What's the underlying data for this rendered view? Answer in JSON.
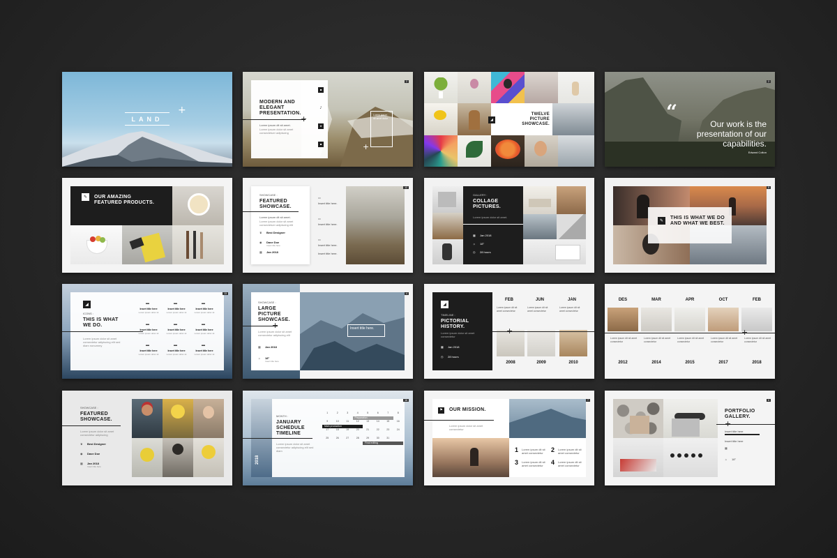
{
  "s1": {
    "brand": "LAND"
  },
  "s2": {
    "title": "MODERN AND ELEGANT PRESENTATION.",
    "page": "2",
    "body": "Lorem ipsum dit sit amet.",
    "side": "Lorem ipsum sit amet dolor"
  },
  "s3": {
    "title": "TWELVE PICTURE SHOWCASE."
  },
  "s4": {
    "quote": "Our work is the presentation of our capabilities.",
    "author": "Edward Colton",
    "page": "2"
  },
  "s5": {
    "title": "OUR AMAZING FEATURED PRODUCTS."
  },
  "s6": {
    "label": "SHOWCASE :",
    "title": "FEATURED SHOWCASE.",
    "page": "12",
    "body": "Lorem ipsum dit sit amet.",
    "items": [
      "Best Designer",
      "Dave Doe",
      "Jan 2018"
    ],
    "sub": "Insert title here",
    "insert": [
      "Insert title here.",
      "Insert title here.",
      "Insert title here.",
      "Insert title here."
    ]
  },
  "s7": {
    "label": "GALLERY :",
    "title": "COLLAGE PICTURES.",
    "items": [
      "Jan 2018",
      "18°",
      "28 hours"
    ]
  },
  "s8": {
    "title": "THIS IS WHAT WE DO AND WHAT WE BEST.",
    "page": "8"
  },
  "s9": {
    "label": "ICONS :",
    "title": "THIS IS WHAT WE DO.",
    "page": "13",
    "insert": "Insert title here"
  },
  "s10": {
    "label": "SHOWCASE :",
    "title": "LARGE PICTURE SHOWCASE.",
    "items": [
      "Jan 2018",
      "18°"
    ],
    "insert": "Insert title here.",
    "page": "4",
    "sub": "Insert title here"
  },
  "s11": {
    "label": "TIMELINE :",
    "title": "PICTORIAL HISTORY.",
    "items": [
      "Jan 2018",
      "28 hours"
    ],
    "months": [
      "FEB",
      "JUN",
      "JAN"
    ],
    "years": [
      "2008",
      "2009",
      "2010"
    ]
  },
  "s12": {
    "months": [
      "DES",
      "MAR",
      "APR",
      "OCT",
      "FEB"
    ],
    "years": [
      "2012",
      "2014",
      "2015",
      "2017",
      "2018"
    ]
  },
  "s13": {
    "label": "SHOWCASE :",
    "title": "FEATURED SHOWCASE.",
    "items": [
      "Best Designer",
      "Dave Doe",
      "Jan 2018"
    ],
    "sub": "Insert title here"
  },
  "s14": {
    "label": "MONTH :",
    "title": "JANUARY SCHEDULE TIMELINE",
    "year": "2018",
    "page": "16",
    "bars": [
      "Preparation",
      "Main production",
      "Final editing"
    ]
  },
  "s15": {
    "title": "OUR MISSION.",
    "nums": [
      "1",
      "2",
      "3",
      "4"
    ],
    "page": "7"
  },
  "s16": {
    "title": "PORTFOLIO GALLERY.",
    "page": "6",
    "items": [
      "Insert title here",
      "Insert title here",
      "18°"
    ]
  },
  "colors": {
    "bg": "#262626",
    "dark": "#1d1d1d",
    "accent": "#ffffff"
  }
}
